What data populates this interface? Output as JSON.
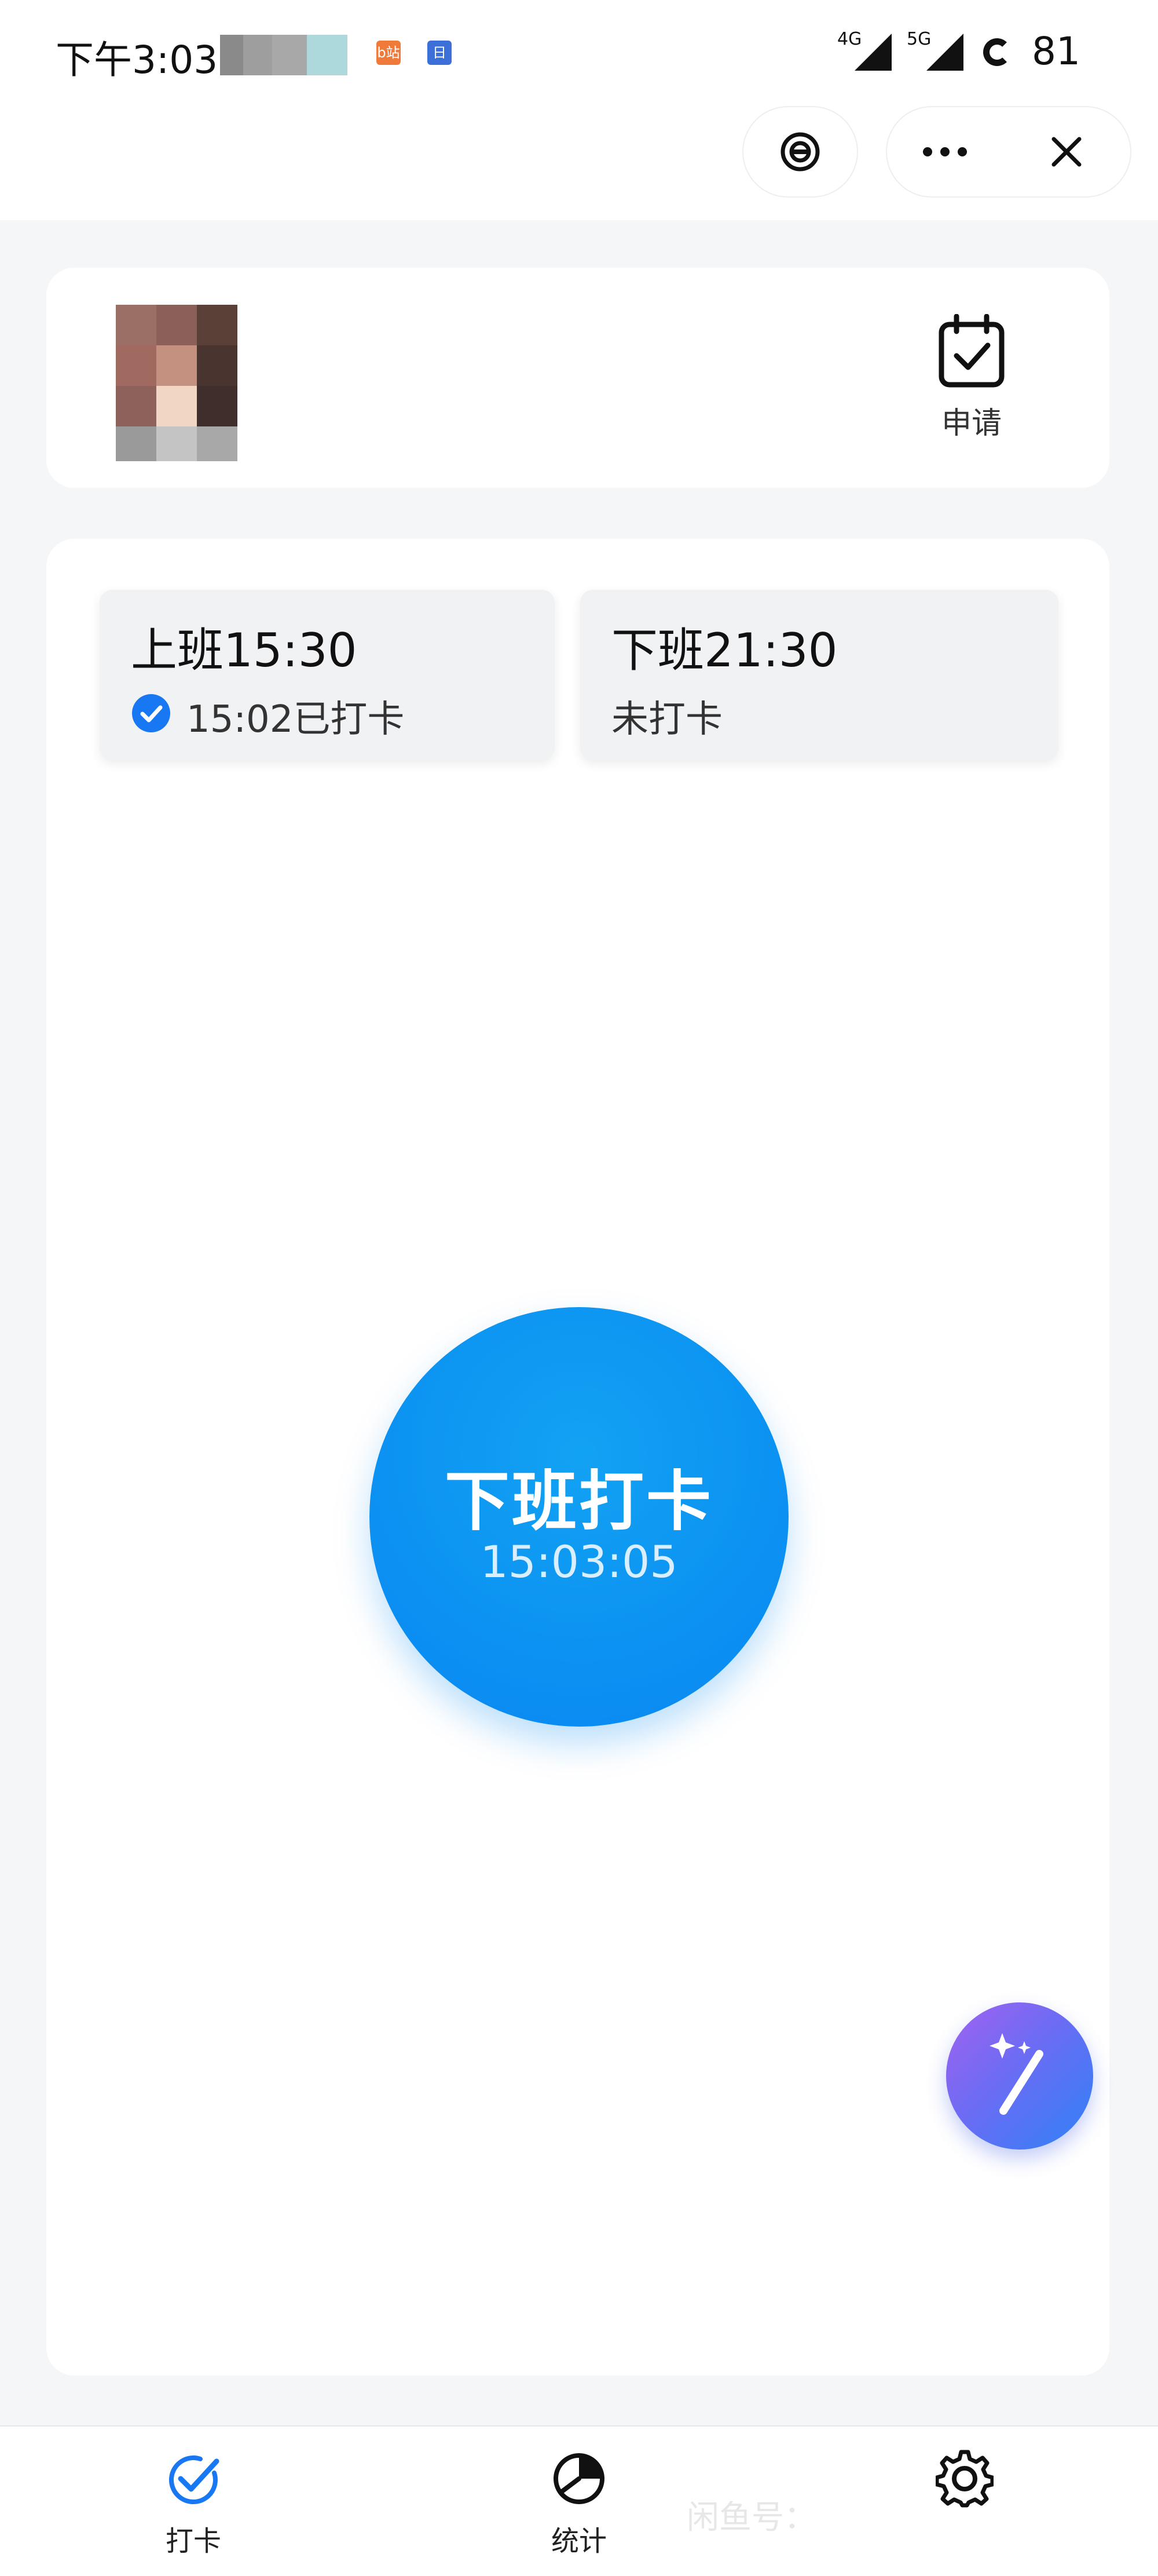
{
  "status_bar": {
    "time": "下午3:03",
    "notif_icon_1": "b站",
    "notif_icon_2": "日",
    "network_1": "4G",
    "network_2": "5G",
    "battery": "81"
  },
  "header": {
    "title": "",
    "icons": [
      "target-icon",
      "more-icon",
      "close-icon"
    ]
  },
  "profile": {
    "name": "",
    "department": "",
    "apply_label": "申请"
  },
  "shifts": [
    {
      "title": "上班15:30",
      "status": "15:02已打卡",
      "checked": true
    },
    {
      "title": "下班21:30",
      "status": "未打卡",
      "checked": false
    }
  ],
  "punch": {
    "label": "下班打卡",
    "time": "15:03:05"
  },
  "location": {
    "text": ""
  },
  "bottom_nav": [
    {
      "label": "打卡",
      "icon": "check-icon",
      "active": true
    },
    {
      "label": "统计",
      "icon": "pie-chart-icon",
      "active": false
    },
    {
      "label": "",
      "icon": "gear-icon",
      "active": false
    }
  ],
  "watermark": "闲鱼号：",
  "colors": {
    "primary": "#0c93f2",
    "check_blue": "#1877f2",
    "fab_purple": "#a262f0",
    "fab_blue": "#2f82f6"
  }
}
